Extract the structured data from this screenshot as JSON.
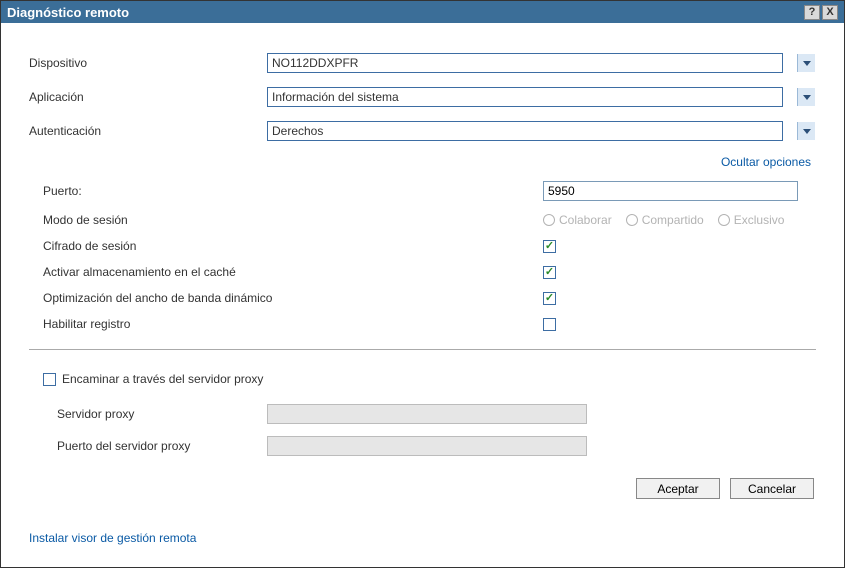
{
  "window": {
    "title": "Diagnóstico remoto",
    "help_icon": "?",
    "close_icon": "X"
  },
  "form": {
    "device_label": "Dispositivo",
    "device_value": "NO112DDXPFR",
    "application_label": "Aplicación",
    "application_value": "Información del sistema",
    "auth_label": "Autenticación",
    "auth_value": "Derechos"
  },
  "links": {
    "hide_options": "Ocultar opciones",
    "install_viewer": "Instalar visor de gestión remota"
  },
  "options": {
    "port_label": "Puerto:",
    "port_value": "5950",
    "session_mode_label": "Modo de sesión",
    "radio_collaborate": "Colaborar",
    "radio_shared": "Compartido",
    "radio_exclusive": "Exclusivo",
    "encryption_label": "Cifrado de sesión",
    "caching_label": "Activar almacenamiento en el caché",
    "bandwidth_label": "Optimización del ancho de banda dinámico",
    "logging_label": "Habilitar registro"
  },
  "proxy": {
    "route_label": "Encaminar a través del servidor proxy",
    "server_label": "Servidor proxy",
    "port_label": "Puerto del servidor proxy"
  },
  "buttons": {
    "accept": "Aceptar",
    "cancel": "Cancelar"
  }
}
